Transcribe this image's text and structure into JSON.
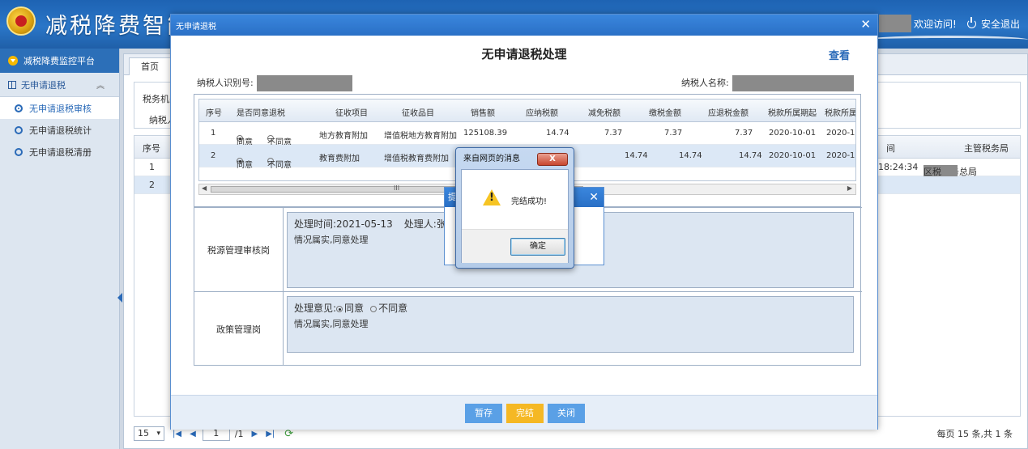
{
  "header": {
    "app_title": "减税降费智能",
    "welcome": "欢迎访问!",
    "logout": "安全退出"
  },
  "sidebar": {
    "platform": "减税降费监控平台",
    "group": "无申请退税",
    "items": [
      {
        "label": "无申请退税审核"
      },
      {
        "label": "无申请退税统计"
      },
      {
        "label": "无申请退税清册"
      }
    ]
  },
  "main": {
    "tab_home": "首页",
    "filter_label_1": "税务机关",
    "filter_label_2": "纳税人",
    "table_head": {
      "seq": "序号",
      "time_col": "间",
      "office_col": "主管税务局"
    },
    "rows": [
      {
        "seq": "1",
        "time": "18:24:34",
        "office": "国家税务总局",
        "office_suffix": "区税"
      },
      {
        "seq": "2"
      }
    ],
    "pager": {
      "page_size": "15",
      "page": "1",
      "total_pages": "/1",
      "info": "每页 15 条,共 1 条"
    }
  },
  "modal": {
    "title": "无申请退税",
    "heading": "无申请退税处理",
    "view": "查看",
    "taxpayer_id_label": "纳税人识别号:",
    "taxpayer_name_label": "纳税人名称:",
    "columns": [
      "序号",
      "是否同意退税",
      "征收项目",
      "征收品目",
      "销售额",
      "应纳税额",
      "减免税额",
      "缴税金额",
      "应退税金额",
      "税款所属期起",
      "税款所属"
    ],
    "rows": [
      {
        "seq": "1",
        "agree": "同意",
        "disagree": "不同意",
        "item": "地方教育附加",
        "sub_item": "增值税地方教育附加",
        "sales": "125108.39",
        "payable": "14.74",
        "reduced": "7.37",
        "paid": "7.37",
        "refund": "7.37",
        "period_start": "2020-10-01",
        "period_end": "2020-1"
      },
      {
        "seq": "2",
        "agree": "同意",
        "disagree": "不同意",
        "item": "教育费附加",
        "sub_item": "增值税教育费附加",
        "sales": "",
        "payable": "",
        "reduced": "14.74",
        "paid": "14.74",
        "refund": "14.74",
        "period_start": "2020-10-01",
        "period_end": "2020-1"
      }
    ],
    "review_1": {
      "label": "税源管理审核岗",
      "time_label": "处理时间:",
      "time": "2021-05-13",
      "handler_label": "处理人:",
      "handler": "张",
      "comment": "情况属实,同意处理"
    },
    "review_2": {
      "label": "政策管理岗",
      "opinion_label": "处理意见:",
      "agree": "同意",
      "disagree": "不同意",
      "comment": "情况属实,同意处理"
    },
    "buttons": {
      "save": "暂存",
      "finish": "完结",
      "close": "关闭"
    }
  },
  "tip_dialog": {
    "title": "提"
  },
  "alert": {
    "title": "来自网页的消息",
    "message": "完结成功!",
    "ok": "确定",
    "close": "X"
  }
}
